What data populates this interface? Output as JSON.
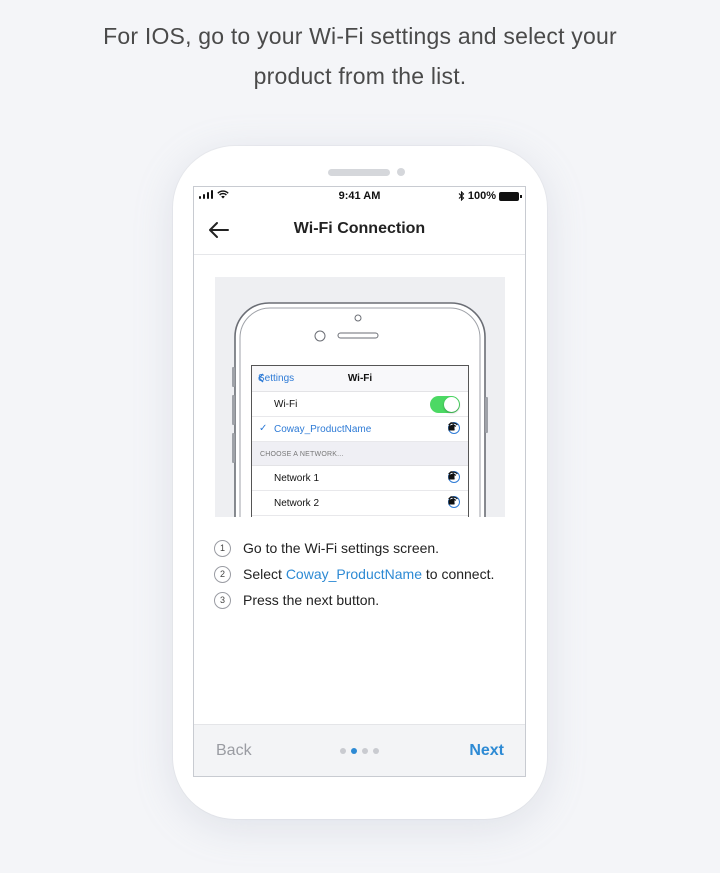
{
  "headline": {
    "line1": "For IOS, go to your Wi-Fi settings and select your",
    "line2": "product from the list."
  },
  "status_bar": {
    "time": "9:41 AM",
    "battery": "100%",
    "icons": [
      "signal-icon",
      "wifi-icon",
      "bluetooth-icon",
      "battery-icon"
    ]
  },
  "app_bar": {
    "title": "Wi-Fi Connection",
    "back_icon": "arrow-left-icon"
  },
  "illustration": {
    "nav_back": "Settings",
    "nav_title": "Wi-Fi",
    "wifi_label": "Wi-Fi",
    "wifi_on": true,
    "connected_network": "Coway_ProductName",
    "section_header": "CHOOSE A NETWORK...",
    "networks": [
      "Network 1",
      "Network 2"
    ]
  },
  "steps": [
    {
      "num": "1",
      "before": "Go to the Wi-Fi settings screen.",
      "highlight": "",
      "after": ""
    },
    {
      "num": "2",
      "before": "Select ",
      "highlight": "Coway_ProductName",
      "after": " to connect."
    },
    {
      "num": "3",
      "before": "Press the next button.",
      "highlight": "",
      "after": ""
    }
  ],
  "footer": {
    "back_label": "Back",
    "next_label": "Next",
    "page_total": 4,
    "page_current": 2
  },
  "colors": {
    "accent": "#2d8ad4",
    "toggle_on": "#4cd964",
    "background": "#f4f5f8"
  }
}
